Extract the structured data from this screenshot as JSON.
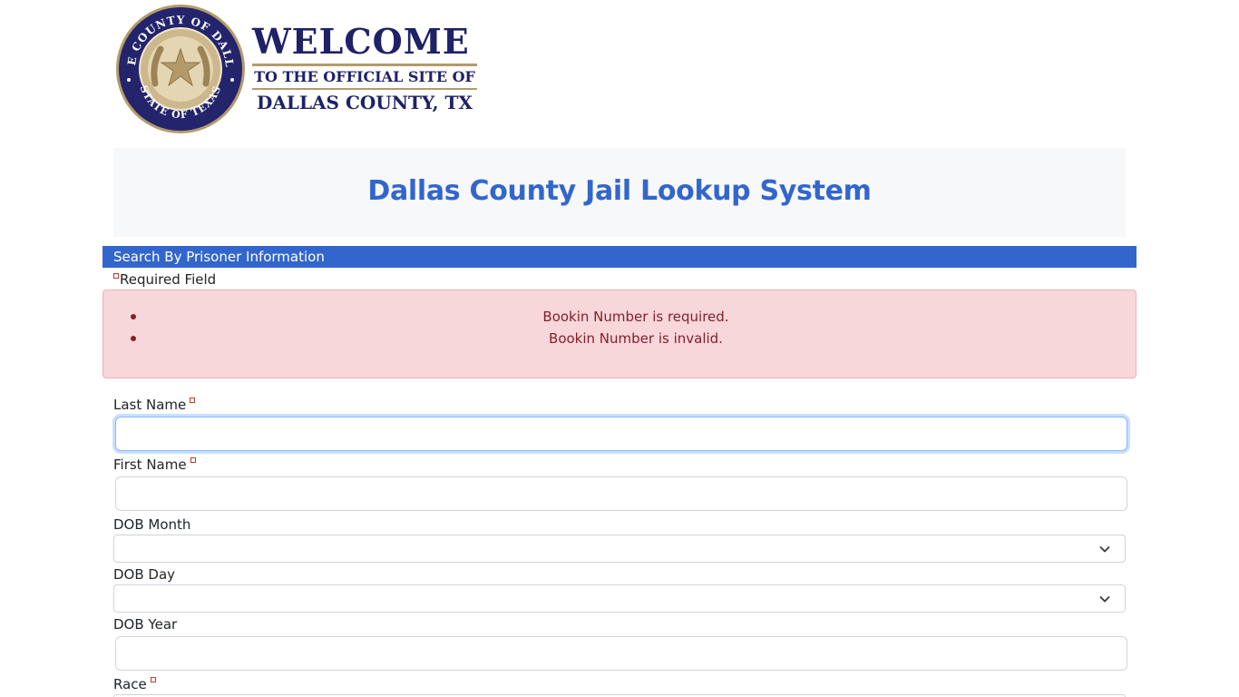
{
  "header": {
    "welcome": "WELCOME",
    "subtitle": "TO THE OFFICIAL SITE OF",
    "county": "DALLAS COUNTY, TX",
    "seal_top_text": "THE COUNTY OF DALLAS",
    "seal_bottom_text": "STATE OF TEXAS"
  },
  "page_title": "Dallas County Jail Lookup System",
  "section": {
    "title": "Search By Prisoner Information",
    "required_note": "Required Field"
  },
  "errors": [
    "Bookin Number is required.",
    "Bookin Number is invalid."
  ],
  "form": {
    "last_name": {
      "label": "Last Name",
      "value": "",
      "required": true
    },
    "first_name": {
      "label": "First Name",
      "value": "",
      "required": true
    },
    "dob_month": {
      "label": "DOB Month",
      "selected": ""
    },
    "dob_day": {
      "label": "DOB Day",
      "selected": ""
    },
    "dob_year": {
      "label": "DOB Year",
      "value": ""
    },
    "race": {
      "label": "Race",
      "required": true
    }
  },
  "colors": {
    "accent": "#3366cc",
    "seal_navy": "#1f2266",
    "seal_gold": "#b49a6b",
    "alert_bg": "#f8d7da",
    "alert_text": "#842029"
  }
}
